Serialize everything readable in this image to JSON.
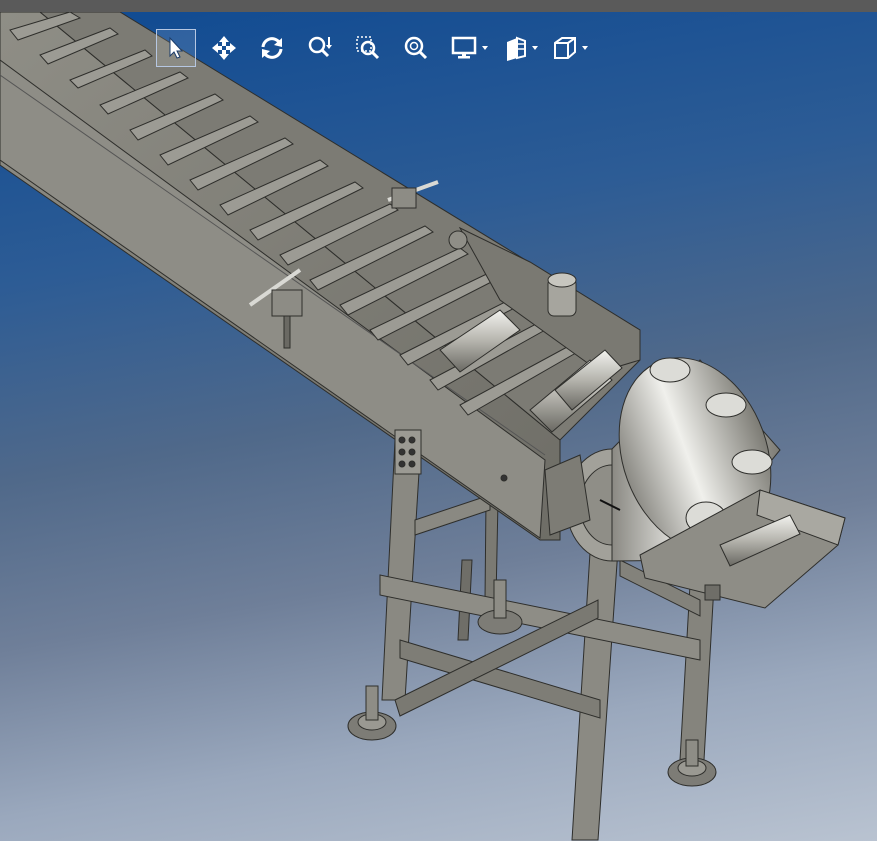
{
  "window": {
    "bar_color": "#5a5a5a"
  },
  "viewport": {
    "background_top": "#0f4a92",
    "background_bottom": "#b9c3d1",
    "model": "conveyor-assembly"
  },
  "toolbar": {
    "buttons": [
      {
        "id": "select",
        "icon": "select-arrow-icon",
        "active": true
      },
      {
        "id": "pan",
        "icon": "pan-icon"
      },
      {
        "id": "rotate",
        "icon": "rotate-icon"
      },
      {
        "id": "zoom-in-out",
        "icon": "zoom-in-out-icon"
      },
      {
        "id": "zoom-area",
        "icon": "zoom-area-icon"
      },
      {
        "id": "zoom-fit",
        "icon": "zoom-fit-icon"
      },
      {
        "id": "display-style",
        "icon": "monitor-icon",
        "dropdown": true
      },
      {
        "id": "section-view",
        "icon": "section-view-icon",
        "dropdown": true
      },
      {
        "id": "view-orientation",
        "icon": "cube-icon",
        "dropdown": true
      }
    ],
    "icon_color": "#ffffff"
  }
}
